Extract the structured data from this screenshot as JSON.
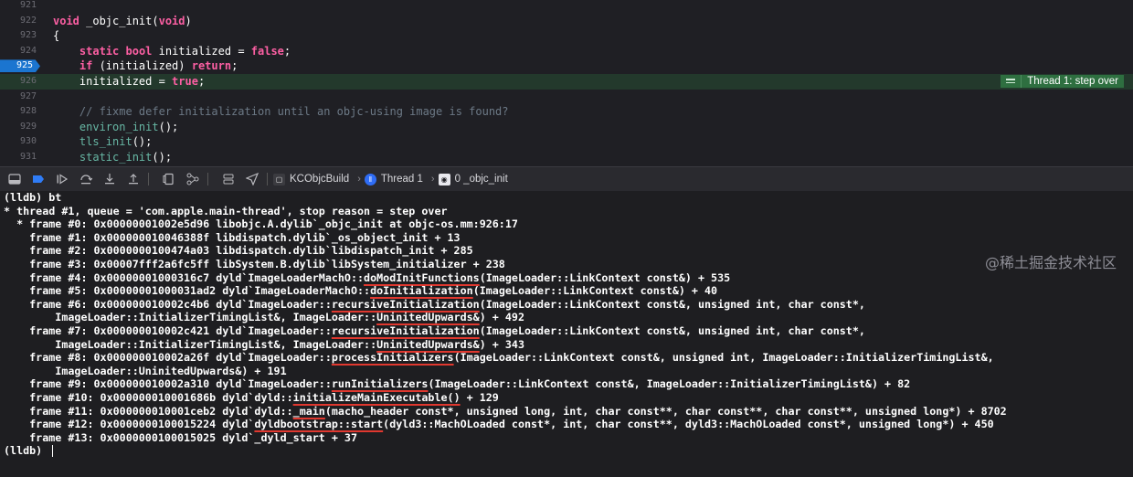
{
  "editor": {
    "lines": [
      {
        "num": "921",
        "segs": []
      },
      {
        "num": "922",
        "segs": [
          {
            "c": "kw",
            "t": "void"
          },
          {
            "c": "plain",
            "t": " _objc_init("
          },
          {
            "c": "kw",
            "t": "void"
          },
          {
            "c": "plain",
            "t": ")"
          }
        ]
      },
      {
        "num": "923",
        "segs": [
          {
            "c": "plain",
            "t": "{"
          }
        ]
      },
      {
        "num": "924",
        "segs": [
          {
            "c": "plain",
            "t": "    "
          },
          {
            "c": "kw",
            "t": "static"
          },
          {
            "c": "plain",
            "t": " "
          },
          {
            "c": "kw",
            "t": "bool"
          },
          {
            "c": "plain",
            "t": " initialized = "
          },
          {
            "c": "kw",
            "t": "false"
          },
          {
            "c": "plain",
            "t": ";"
          }
        ]
      },
      {
        "num": "925",
        "active": true,
        "segs": [
          {
            "c": "plain",
            "t": "    "
          },
          {
            "c": "kw",
            "t": "if"
          },
          {
            "c": "plain",
            "t": " (initialized) "
          },
          {
            "c": "kw",
            "t": "return"
          },
          {
            "c": "plain",
            "t": ";"
          }
        ]
      },
      {
        "num": "926",
        "highlight": true,
        "segs": [
          {
            "c": "plain",
            "t": "    initialized = "
          },
          {
            "c": "kw",
            "t": "true"
          },
          {
            "c": "plain",
            "t": ";"
          }
        ]
      },
      {
        "num": "927",
        "segs": []
      },
      {
        "num": "928",
        "segs": [
          {
            "c": "plain",
            "t": "    "
          },
          {
            "c": "cm",
            "t": "// fixme defer initialization until an objc-using image is found?"
          }
        ]
      },
      {
        "num": "929",
        "segs": [
          {
            "c": "plain",
            "t": "    "
          },
          {
            "c": "fn",
            "t": "environ_init"
          },
          {
            "c": "plain",
            "t": "();"
          }
        ]
      },
      {
        "num": "930",
        "segs": [
          {
            "c": "plain",
            "t": "    "
          },
          {
            "c": "fn",
            "t": "tls_init"
          },
          {
            "c": "plain",
            "t": "();"
          }
        ]
      },
      {
        "num": "931",
        "segs": [
          {
            "c": "plain",
            "t": "    "
          },
          {
            "c": "fn",
            "t": "static_init"
          },
          {
            "c": "plain",
            "t": "();"
          }
        ]
      }
    ],
    "thread_badge": "Thread 1: step over"
  },
  "debugbar": {
    "icons": [
      "hide-debug-area-icon",
      "breakpoints-toggle-icon",
      "continue-icon",
      "step-over-icon",
      "step-into-icon",
      "step-out-icon",
      "view-hierarchy-icon",
      "memory-graph-icon",
      "environment-overrides-icon",
      "simulate-location-icon"
    ],
    "crumbs": [
      {
        "icon": "target-icon",
        "label": "KCObjcBuild"
      },
      {
        "icon": "thread-icon",
        "label": "Thread 1"
      },
      {
        "icon": "frame-icon",
        "label": "0 _objc_init"
      }
    ]
  },
  "console": {
    "lines": [
      [
        {
          "t": "(lldb) bt"
        }
      ],
      [
        {
          "t": "* thread #1, queue = 'com.apple.main-thread', stop reason = step over"
        }
      ],
      [
        {
          "t": "  * frame #0: 0x00000001002e5d96 libobjc.A.dylib`_objc_init at objc-os.mm:926:17"
        }
      ],
      [
        {
          "t": "    frame #1: 0x000000010046388f libdispatch.dylib`_os_object_init + 13"
        }
      ],
      [
        {
          "t": "    frame #2: 0x0000000100474a03 libdispatch.dylib`libdispatch_init + 285"
        }
      ],
      [
        {
          "t": "    frame #3: 0x00007fff2a6fc5ff libSystem.B.dylib`libSystem_initializer + 238"
        }
      ],
      [
        {
          "t": "    frame #4: 0x00000001000316c7 dyld`ImageLoaderMachO::"
        },
        {
          "t": "doModInitFunctions",
          "u": true
        },
        {
          "t": "(ImageLoader::LinkContext const&) + 535"
        }
      ],
      [
        {
          "t": "    frame #5: 0x00000001000031ad2 dyld`ImageLoaderMachO::"
        },
        {
          "t": "doInitialization",
          "u": true
        },
        {
          "t": "(ImageLoader::LinkContext const&) + 40"
        }
      ],
      [
        {
          "t": "    frame #6: 0x000000010002c4b6 dyld`ImageLoader::"
        },
        {
          "t": "recursiveInitialization",
          "u": true
        },
        {
          "t": "(ImageLoader::LinkContext const&, unsigned int, char const*,"
        }
      ],
      [
        {
          "t": "        ImageLoader::InitializerTimingList&, ImageLoader::"
        },
        {
          "t": "UninitedUpwards&",
          "u": true
        },
        {
          "t": ") + 492"
        }
      ],
      [
        {
          "t": "    frame #7: 0x000000010002c421 dyld`ImageLoader::"
        },
        {
          "t": "recursiveInitialization",
          "u": true
        },
        {
          "t": "(ImageLoader::LinkContext const&, unsigned int, char const*,"
        }
      ],
      [
        {
          "t": "        ImageLoader::InitializerTimingList&, ImageLoader::"
        },
        {
          "t": "UninitedUpwards&",
          "u": true
        },
        {
          "t": ") + 343"
        }
      ],
      [
        {
          "t": "    frame #8: 0x000000010002a26f dyld`ImageLoader::"
        },
        {
          "t": "processInitializers",
          "u": true
        },
        {
          "t": "(ImageLoader::LinkContext const&, unsigned int, ImageLoader::InitializerTimingList&,"
        }
      ],
      [
        {
          "t": "        ImageLoader::UninitedUpwards&) + 191"
        }
      ],
      [
        {
          "t": "    frame #9: 0x000000010002a310 dyld`ImageLoader::"
        },
        {
          "t": "runInitializers",
          "u": true
        },
        {
          "t": "(ImageLoader::LinkContext const&, ImageLoader::InitializerTimingList&) + 82"
        }
      ],
      [
        {
          "t": "    frame #10: 0x000000010001686b dyld`dyld::"
        },
        {
          "t": "initializeMainExecutable()",
          "u": true
        },
        {
          "t": " + 129"
        }
      ],
      [
        {
          "t": "    frame #11: 0x000000010001ceb2 dyld`dyld::"
        },
        {
          "t": "_main",
          "u": true
        },
        {
          "t": "(macho_header const*, unsigned long, int, char const**, char const**, char const**, unsigned long*) + 8702"
        }
      ],
      [
        {
          "t": "    frame #12: 0x0000000100015224 dyld`"
        },
        {
          "t": "dyldbootstrap::start",
          "u": true
        },
        {
          "t": "(dyld3::MachOLoaded const*, int, char const**, dyld3::MachOLoaded const*, unsigned long*) + 450"
        }
      ],
      [
        {
          "t": "    frame #13: 0x0000000100015025 dyld`_dyld_start + 37"
        }
      ],
      [
        {
          "t": "(lldb) "
        }
      ]
    ]
  },
  "watermark": "@稀土掘金技术社区"
}
